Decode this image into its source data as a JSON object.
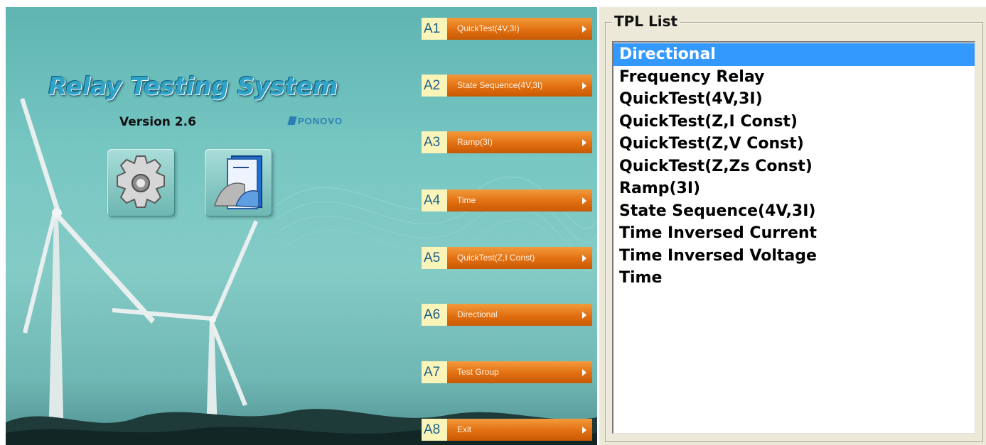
{
  "splash": {
    "title": "Relay Testing System",
    "version": "Version 2.6",
    "brand": "PONOVO",
    "icons": [
      "gear-icon",
      "test-module-icon"
    ]
  },
  "menu": [
    {
      "code": "A1",
      "label": "QuickTest(4V,3I)"
    },
    {
      "code": "A2",
      "label": "State Sequence(4V,3I)"
    },
    {
      "code": "A3",
      "label": "Ramp(3I)"
    },
    {
      "code": "A4",
      "label": "Time"
    },
    {
      "code": "A5",
      "label": "QuickTest(Z,I Const)"
    },
    {
      "code": "A6",
      "label": "Directional"
    },
    {
      "code": "A7",
      "label": "Test Group"
    },
    {
      "code": "A8",
      "label": "Exit"
    }
  ],
  "tpl": {
    "title": "TPL List",
    "selected_index": 0,
    "items": [
      "Directional",
      "Frequency Relay",
      "QuickTest(4V,3I)",
      "QuickTest(Z,I Const)",
      "QuickTest(Z,V Const)",
      "QuickTest(Z,Zs Const)",
      "Ramp(3I)",
      "State Sequence(4V,3I)",
      "Time Inversed Current",
      "Time Inversed Voltage",
      "Time"
    ]
  },
  "colors": {
    "menu_bar": "#e26f10",
    "menu_code_bg": "#fbf4b8",
    "selection": "#3399ff"
  }
}
